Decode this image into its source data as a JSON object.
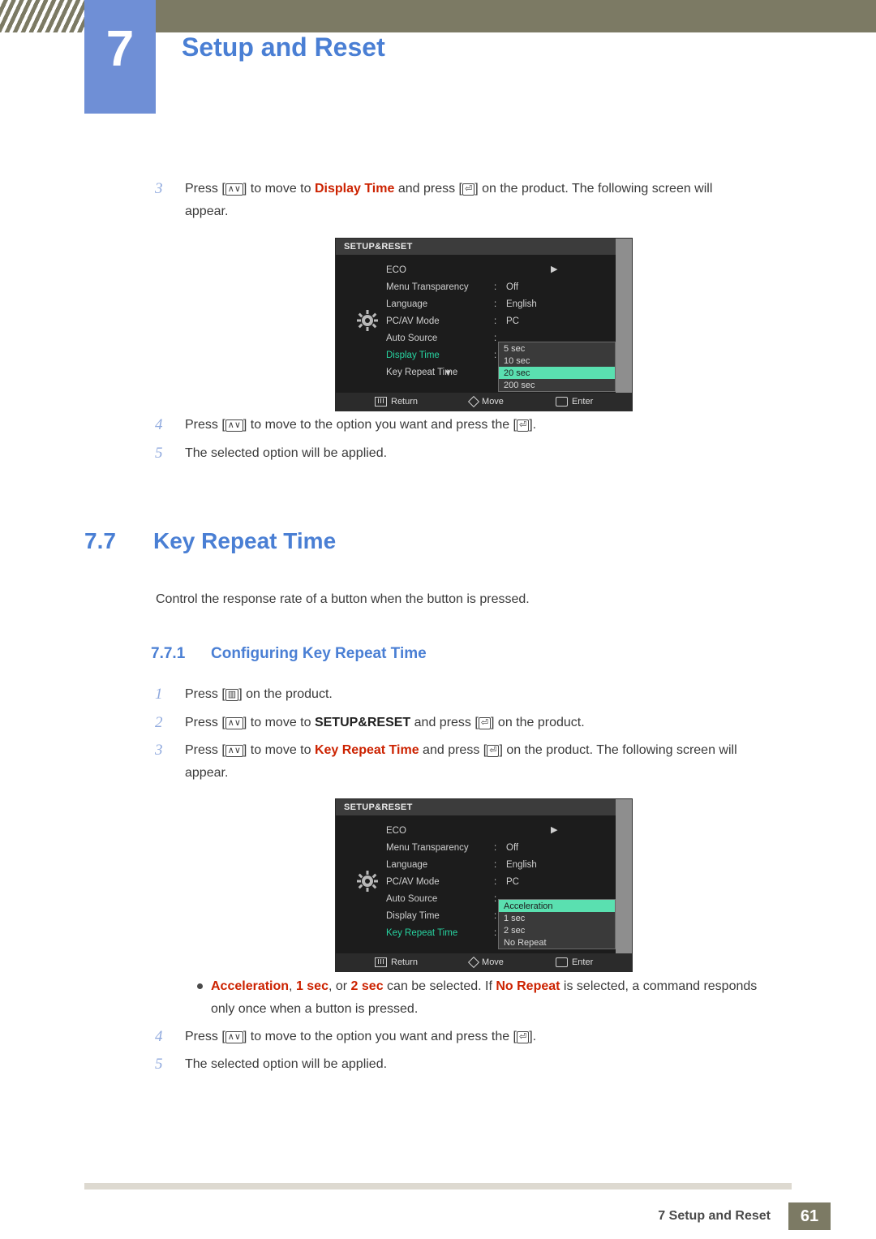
{
  "header": {
    "chapter_number": "7",
    "chapter_title": "Setup and Reset"
  },
  "section_display_time": {
    "step3": {
      "num": "3",
      "text_a": "Press [",
      "key1": "∧∨",
      "text_b": "] to move to ",
      "bold_blue": "Display Time",
      "text_c": " and press [",
      "key2": "enter-icon",
      "text_d": "] on the product. The following screen will",
      "text_e": "appear."
    },
    "step4": {
      "num": "4",
      "text_a": "Press [",
      "text_b": "] to move to the option you want and press the [",
      "text_c": "]."
    },
    "step5": {
      "num": "5",
      "text": "The selected option will be applied."
    }
  },
  "osd1": {
    "title": "SETUP&RESET",
    "rows": [
      {
        "label": "ECO",
        "colon": "",
        "value": "",
        "selected": false,
        "arrow": "▶"
      },
      {
        "label": "Menu Transparency",
        "colon": ":",
        "value": "Off",
        "selected": false
      },
      {
        "label": "Language",
        "colon": ":",
        "value": "English",
        "selected": false
      },
      {
        "label": "PC/AV Mode",
        "colon": ":",
        "value": "PC",
        "selected": false
      },
      {
        "label": "Auto Source",
        "colon": ":",
        "value": "",
        "selected": false
      },
      {
        "label": "Display Time",
        "colon": ":",
        "value": "",
        "selected": true
      },
      {
        "label": "Key Repeat Time",
        "colon": "",
        "value": "",
        "selected": false
      }
    ],
    "popup": [
      "5 sec",
      "10 sec",
      "20 sec",
      "200 sec"
    ],
    "popup_highlight_index": 2,
    "footer": {
      "return": "Return",
      "move": "Move",
      "enter": "Enter"
    }
  },
  "section_key_repeat": {
    "number": "7.7",
    "title": "Key Repeat Time",
    "description": "Control the response rate of a button when the button is pressed.",
    "subsection_number": "7.7.1",
    "subsection_title": "Configuring Key Repeat Time",
    "step1": {
      "num": "1",
      "text_a": "Press [",
      "text_b": "] on the product.",
      "key": "menu-icon"
    },
    "step2": {
      "num": "2",
      "text_a": "Press [",
      "text_b": "] to move to ",
      "bold": "SETUP&RESET",
      "text_c": " and press [",
      "text_d": "] on the product."
    },
    "step3": {
      "num": "3",
      "text_a": "Press [",
      "text_b": "] to move to ",
      "bold_blue": "Key Repeat Time",
      "text_c": " and press [",
      "text_d": "] on the product. The following screen will",
      "text_e": "appear."
    },
    "bullet": {
      "b1": "Acceleration",
      "sep1": ", ",
      "b2": "1 sec",
      "sep2": ", or ",
      "b3": "2 sec",
      "mid": " can be selected. If ",
      "b4": "No Repeat",
      "tail": " is selected, a command responds",
      "line2": "only once when a button is pressed."
    },
    "step4": {
      "num": "4",
      "text_a": "Press [",
      "text_b": "] to move to the option you want and press the [",
      "text_c": "]."
    },
    "step5": {
      "num": "5",
      "text": "The selected option will be applied."
    }
  },
  "osd2": {
    "title": "SETUP&RESET",
    "rows": [
      {
        "label": "ECO",
        "colon": "",
        "value": "",
        "selected": false,
        "arrow": "▶"
      },
      {
        "label": "Menu Transparency",
        "colon": ":",
        "value": "Off",
        "selected": false
      },
      {
        "label": "Language",
        "colon": ":",
        "value": "English",
        "selected": false
      },
      {
        "label": "PC/AV Mode",
        "colon": ":",
        "value": "PC",
        "selected": false
      },
      {
        "label": "Auto Source",
        "colon": ":",
        "value": "",
        "selected": false
      },
      {
        "label": "Display Time",
        "colon": ":",
        "value": "",
        "selected": false
      },
      {
        "label": "Key Repeat Time",
        "colon": ":",
        "value": "",
        "selected": true
      }
    ],
    "popup": [
      "Acceleration",
      "1 sec",
      "2 sec",
      "No Repeat"
    ],
    "popup_highlight_index": 0,
    "footer": {
      "return": "Return",
      "move": "Move",
      "enter": "Enter"
    }
  },
  "footer": {
    "text": "7 Setup and Reset",
    "page": "61"
  },
  "colors": {
    "accent_blue": "#4a7fd4",
    "chapter_blue": "#6f8fd6",
    "olive": "#7c7a64",
    "highlight_green": "#5ae0b0",
    "red": "#cc2200"
  }
}
